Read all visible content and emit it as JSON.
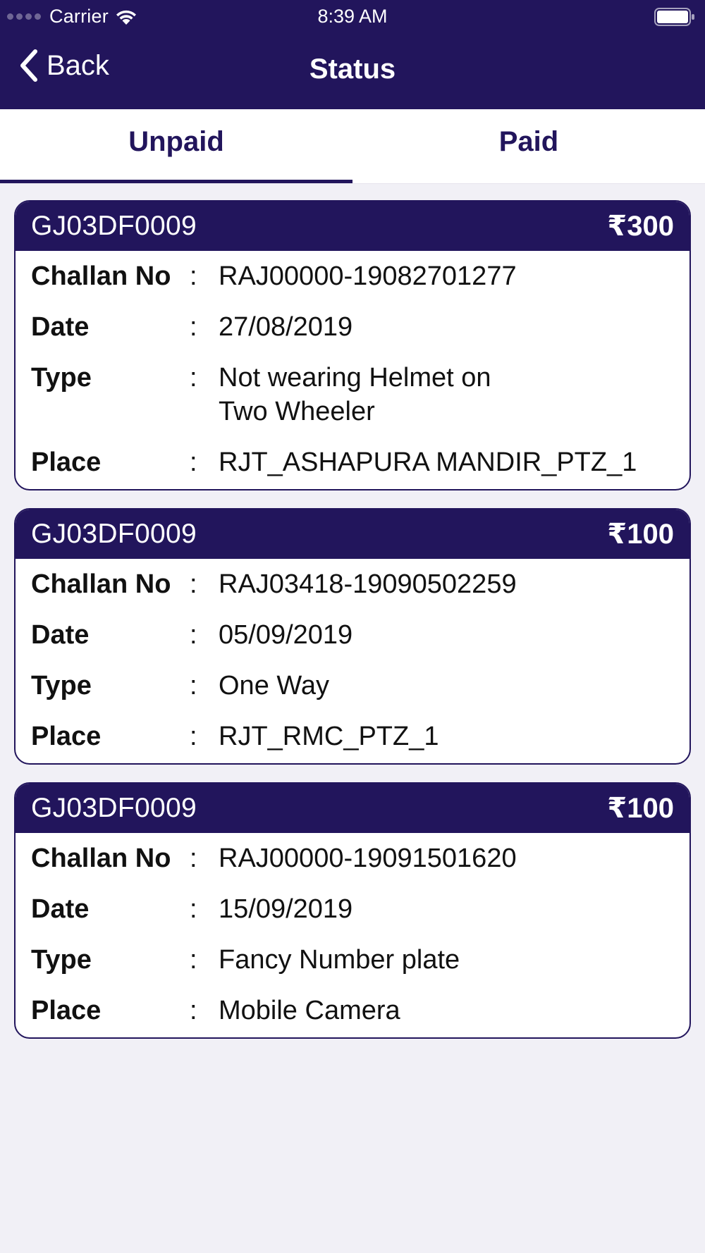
{
  "status_bar": {
    "carrier": "Carrier",
    "time": "8:39 AM"
  },
  "nav": {
    "back_label": "Back",
    "title": "Status"
  },
  "tabs": [
    {
      "label": "Unpaid",
      "active": true
    },
    {
      "label": "Paid",
      "active": false
    }
  ],
  "labels": {
    "challan_no": "Challan No",
    "date": "Date",
    "type": "Type",
    "place": "Place",
    "separator": ":"
  },
  "challans": [
    {
      "vehicle": "GJ03DF0009",
      "amount": "₹300",
      "challan_no": "RAJ00000-19082701277",
      "date": "27/08/2019",
      "type": "Not wearing Helmet on Two Wheeler",
      "place": "RJT_ASHAPURA MANDIR_PTZ_1"
    },
    {
      "vehicle": "GJ03DF0009",
      "amount": "₹100",
      "challan_no": "RAJ03418-19090502259",
      "date": "05/09/2019",
      "type": "One Way",
      "place": "RJT_RMC_PTZ_1"
    },
    {
      "vehicle": "GJ03DF0009",
      "amount": "₹100",
      "challan_no": "RAJ00000-19091501620",
      "date": "15/09/2019",
      "type": "Fancy Number plate",
      "place": "Mobile Camera"
    }
  ],
  "colors": {
    "primary": "#22155c",
    "background": "#f1f0f6",
    "card": "#ffffff"
  },
  "icons": {
    "back": "chevron-left-icon",
    "wifi": "wifi-icon",
    "battery": "battery-icon"
  }
}
